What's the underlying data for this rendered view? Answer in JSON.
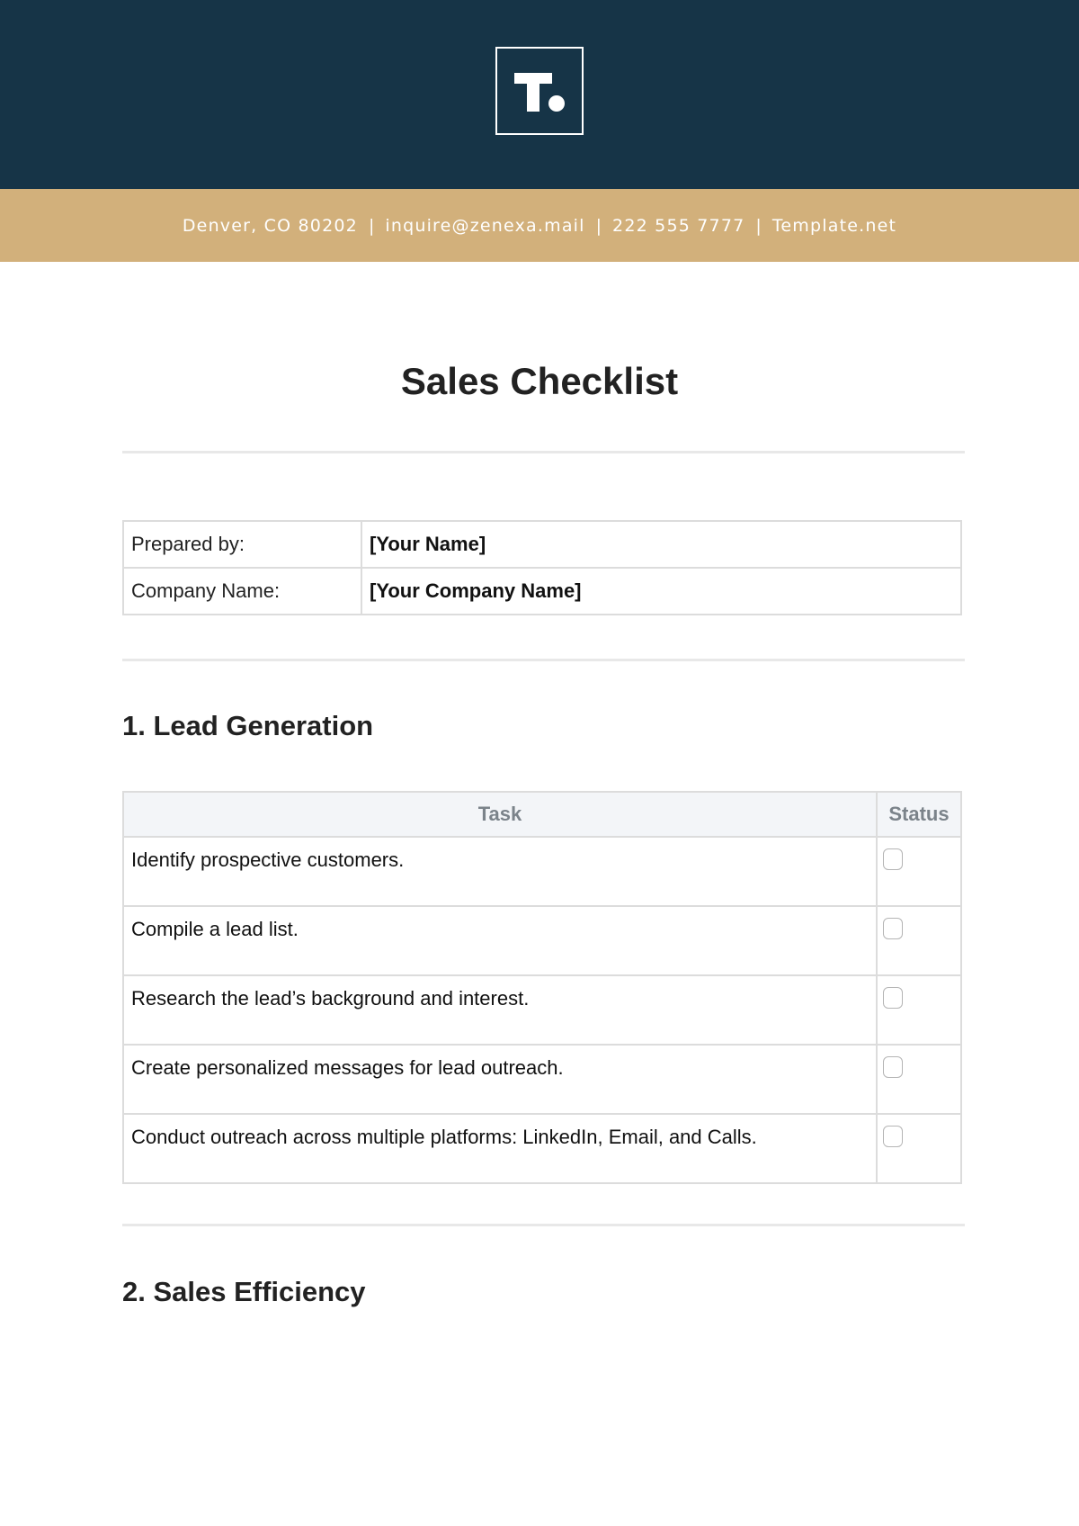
{
  "header": {
    "logo_letter": "T",
    "logo_icon": "template-logo-icon",
    "background_color": "#163447"
  },
  "contact": {
    "background_color": "#d2b07b",
    "items": [
      "Denver, CO 80202",
      "inquire@zenexa.mail",
      "222 555 7777",
      "Template.net"
    ],
    "separator": "|"
  },
  "document": {
    "title": "Sales Checklist"
  },
  "info_table": {
    "rows": [
      {
        "label": "Prepared by:",
        "value": "[Your Name]"
      },
      {
        "label": "Company Name:",
        "value": "[Your Company Name]"
      }
    ]
  },
  "sections": [
    {
      "heading": "1. Lead Generation",
      "columns": [
        "Task",
        "Status"
      ],
      "tasks": [
        {
          "task": "Identify prospective customers.",
          "checked": false
        },
        {
          "task": "Compile a lead list.",
          "checked": false
        },
        {
          "task": "Research the lead’s background and interest.",
          "checked": false
        },
        {
          "task": "Create personalized messages for lead outreach.",
          "checked": false
        },
        {
          "task": "Conduct outreach across multiple platforms: LinkedIn, Email, and Calls.",
          "checked": false
        }
      ]
    },
    {
      "heading": "2. Sales Efficiency"
    }
  ]
}
